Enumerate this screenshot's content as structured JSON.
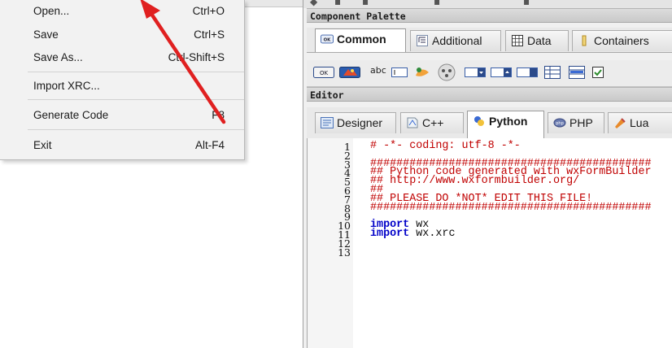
{
  "file_menu": {
    "items": [
      {
        "label": "Open...",
        "shortcut": "Ctrl+O"
      },
      {
        "label": "Save",
        "shortcut": "Ctrl+S"
      },
      {
        "label": "Save As...",
        "shortcut": "Ctrl-Shift+S"
      },
      {
        "label": "Import XRC...",
        "shortcut": ""
      },
      {
        "label": "Generate Code",
        "shortcut": "F8"
      },
      {
        "label": "Exit",
        "shortcut": "Alt-F4"
      }
    ]
  },
  "component_palette": {
    "caption": "Component Palette",
    "tabs": [
      {
        "label": "Common",
        "active": true,
        "icon": "ok-button-icon"
      },
      {
        "label": "Additional",
        "active": false,
        "icon": "tree-icon"
      },
      {
        "label": "Data",
        "active": false,
        "icon": "grid-icon"
      },
      {
        "label": "Containers",
        "active": false,
        "icon": "container-icon"
      }
    ],
    "widgets": {
      "button_label": "OK",
      "static_text_label": "abc"
    }
  },
  "editor": {
    "caption": "Editor",
    "tabs": [
      {
        "label": "Designer",
        "active": false,
        "icon": "designer-icon"
      },
      {
        "label": "C++",
        "active": false,
        "icon": "cpp-icon"
      },
      {
        "label": "Python",
        "active": true,
        "icon": "python-icon"
      },
      {
        "label": "PHP",
        "active": false,
        "icon": "php-icon"
      },
      {
        "label": "Lua",
        "active": false,
        "icon": "lua-icon"
      }
    ],
    "line_numbers": [
      "1",
      "2",
      "3",
      "4",
      "5",
      "6",
      "7",
      "8",
      "9",
      "10",
      "11",
      "12",
      "13"
    ],
    "lines": [
      {
        "kind": "comment",
        "text": "# -*- coding: utf-8 -*-"
      },
      {
        "kind": "blank",
        "text": ""
      },
      {
        "kind": "comment",
        "text": "###########################################"
      },
      {
        "kind": "comment",
        "text": "## Python code generated with wxFormBuilder"
      },
      {
        "kind": "comment",
        "text": "## http://www.wxformbuilder.org/"
      },
      {
        "kind": "comment",
        "text": "##"
      },
      {
        "kind": "comment",
        "text": "## PLEASE DO *NOT* EDIT THIS FILE!"
      },
      {
        "kind": "comment",
        "text": "###########################################"
      },
      {
        "kind": "blank",
        "text": ""
      },
      {
        "kind": "import",
        "keyword": "import",
        "module": "wx"
      },
      {
        "kind": "import",
        "keyword": "import",
        "module": "wx.xrc"
      },
      {
        "kind": "blank",
        "text": ""
      },
      {
        "kind": "blank",
        "text": ""
      }
    ]
  },
  "annotation": {
    "color": "#e02020",
    "type": "arrow"
  }
}
